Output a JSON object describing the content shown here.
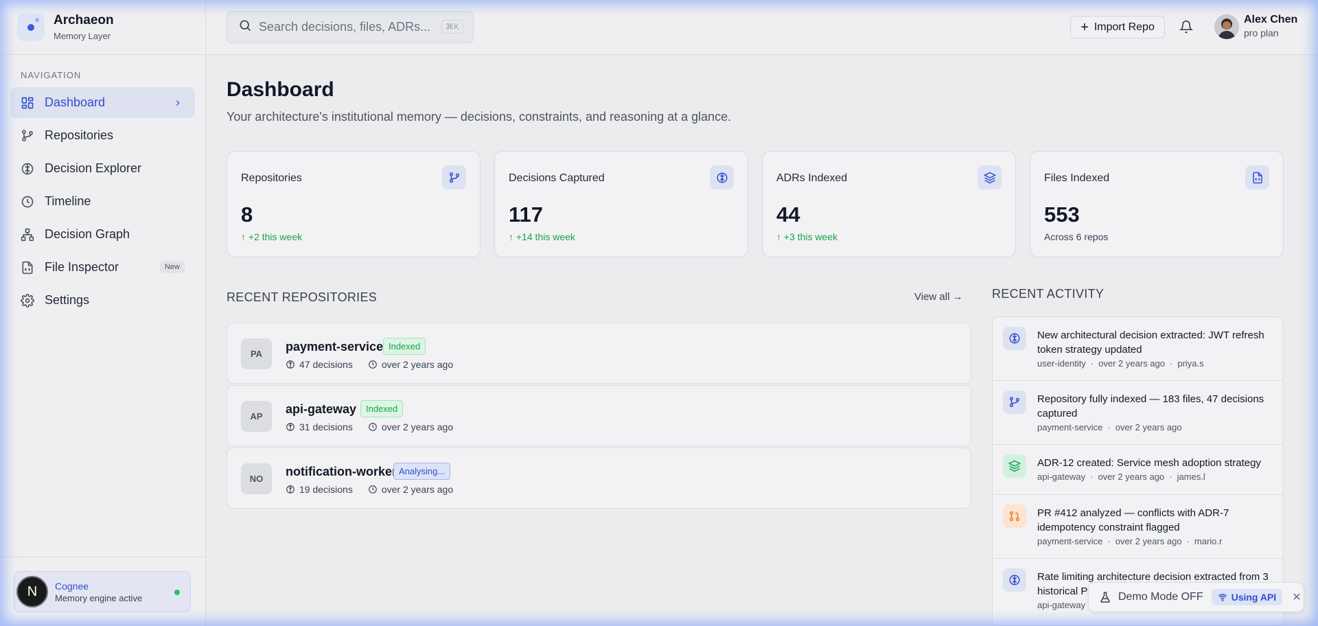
{
  "brand": {
    "title": "Archaeon",
    "subtitle": "Memory Layer"
  },
  "nav": {
    "heading": "NAVIGATION",
    "items": [
      {
        "label": "Dashboard",
        "icon": "grid-icon",
        "active": true
      },
      {
        "label": "Repositories",
        "icon": "git-branch-icon"
      },
      {
        "label": "Decision Explorer",
        "icon": "brain-icon"
      },
      {
        "label": "Timeline",
        "icon": "clock-icon"
      },
      {
        "label": "Decision Graph",
        "icon": "network-icon"
      },
      {
        "label": "File Inspector",
        "icon": "file-code-icon",
        "badge": "New"
      },
      {
        "label": "Settings",
        "icon": "gear-icon"
      }
    ]
  },
  "engine": {
    "initial": "N",
    "name": "Cognee",
    "status": "Memory engine active"
  },
  "search": {
    "placeholder": "Search decisions, files, ADRs...",
    "shortcut": "⌘K"
  },
  "header": {
    "import_label": "Import Repo",
    "user_name": "Alex Chen",
    "user_plan": "pro plan"
  },
  "page": {
    "title": "Dashboard",
    "subtitle": "Your architecture's institutional memory — decisions, constraints, and reasoning at a glance."
  },
  "stats": [
    {
      "label": "Repositories",
      "value": "8",
      "delta": "↑ +2 this week",
      "icon": "git-branch-icon"
    },
    {
      "label": "Decisions Captured",
      "value": "117",
      "delta": "↑ +14 this week",
      "icon": "brain-icon"
    },
    {
      "label": "ADRs Indexed",
      "value": "44",
      "delta": "↑ +3 this week",
      "icon": "layers-icon"
    },
    {
      "label": "Files Indexed",
      "value": "553",
      "delta": "Across 6 repos",
      "icon": "file-code-icon"
    }
  ],
  "recent_repos": {
    "title": "RECENT REPOSITORIES",
    "view_all": "View all →",
    "items": [
      {
        "initials": "PA",
        "name": "payment-service",
        "status": "Indexed",
        "decisions": "47 decisions",
        "updated": "over 2 years ago"
      },
      {
        "initials": "AP",
        "name": "api-gateway",
        "status": "Indexed",
        "decisions": "31 decisions",
        "updated": "over 2 years ago"
      },
      {
        "initials": "NO",
        "name": "notification-worker",
        "status": "Analysing...",
        "decisions": "19 decisions",
        "updated": "over 2 years ago"
      }
    ]
  },
  "recent_activity": {
    "title": "RECENT ACTIVITY",
    "items": [
      {
        "text": "New architectural decision extracted: JWT refresh token strategy updated",
        "repo": "user-identity",
        "time": "over 2 years ago",
        "user": "priya.s",
        "icon": "brain-icon",
        "tone": "blue"
      },
      {
        "text": "Repository fully indexed — 183 files, 47 decisions captured",
        "repo": "payment-service",
        "time": "over 2 years ago",
        "user": "",
        "icon": "git-branch-icon",
        "tone": "blue"
      },
      {
        "text": "ADR-12 created: Service mesh adoption strategy",
        "repo": "api-gateway",
        "time": "over 2 years ago",
        "user": "james.l",
        "icon": "layers-icon",
        "tone": "green"
      },
      {
        "text": "PR #412 analyzed — conflicts with ADR-7 idempotency constraint flagged",
        "repo": "payment-service",
        "time": "over 2 years ago",
        "user": "mario.r",
        "icon": "git-pull-request-icon",
        "tone": "orange"
      },
      {
        "text": "Rate limiting architecture decision extracted from 3 historical PRs",
        "repo": "api-gateway",
        "time": "",
        "user": "",
        "icon": "brain-icon",
        "tone": "blue"
      }
    ]
  },
  "demo": {
    "label": "Demo Mode OFF",
    "api_label": "Using API",
    "close": "✕"
  },
  "colors": {
    "accent": "#2f4fd0",
    "success": "#16a34a",
    "warning": "#f59e0b"
  }
}
